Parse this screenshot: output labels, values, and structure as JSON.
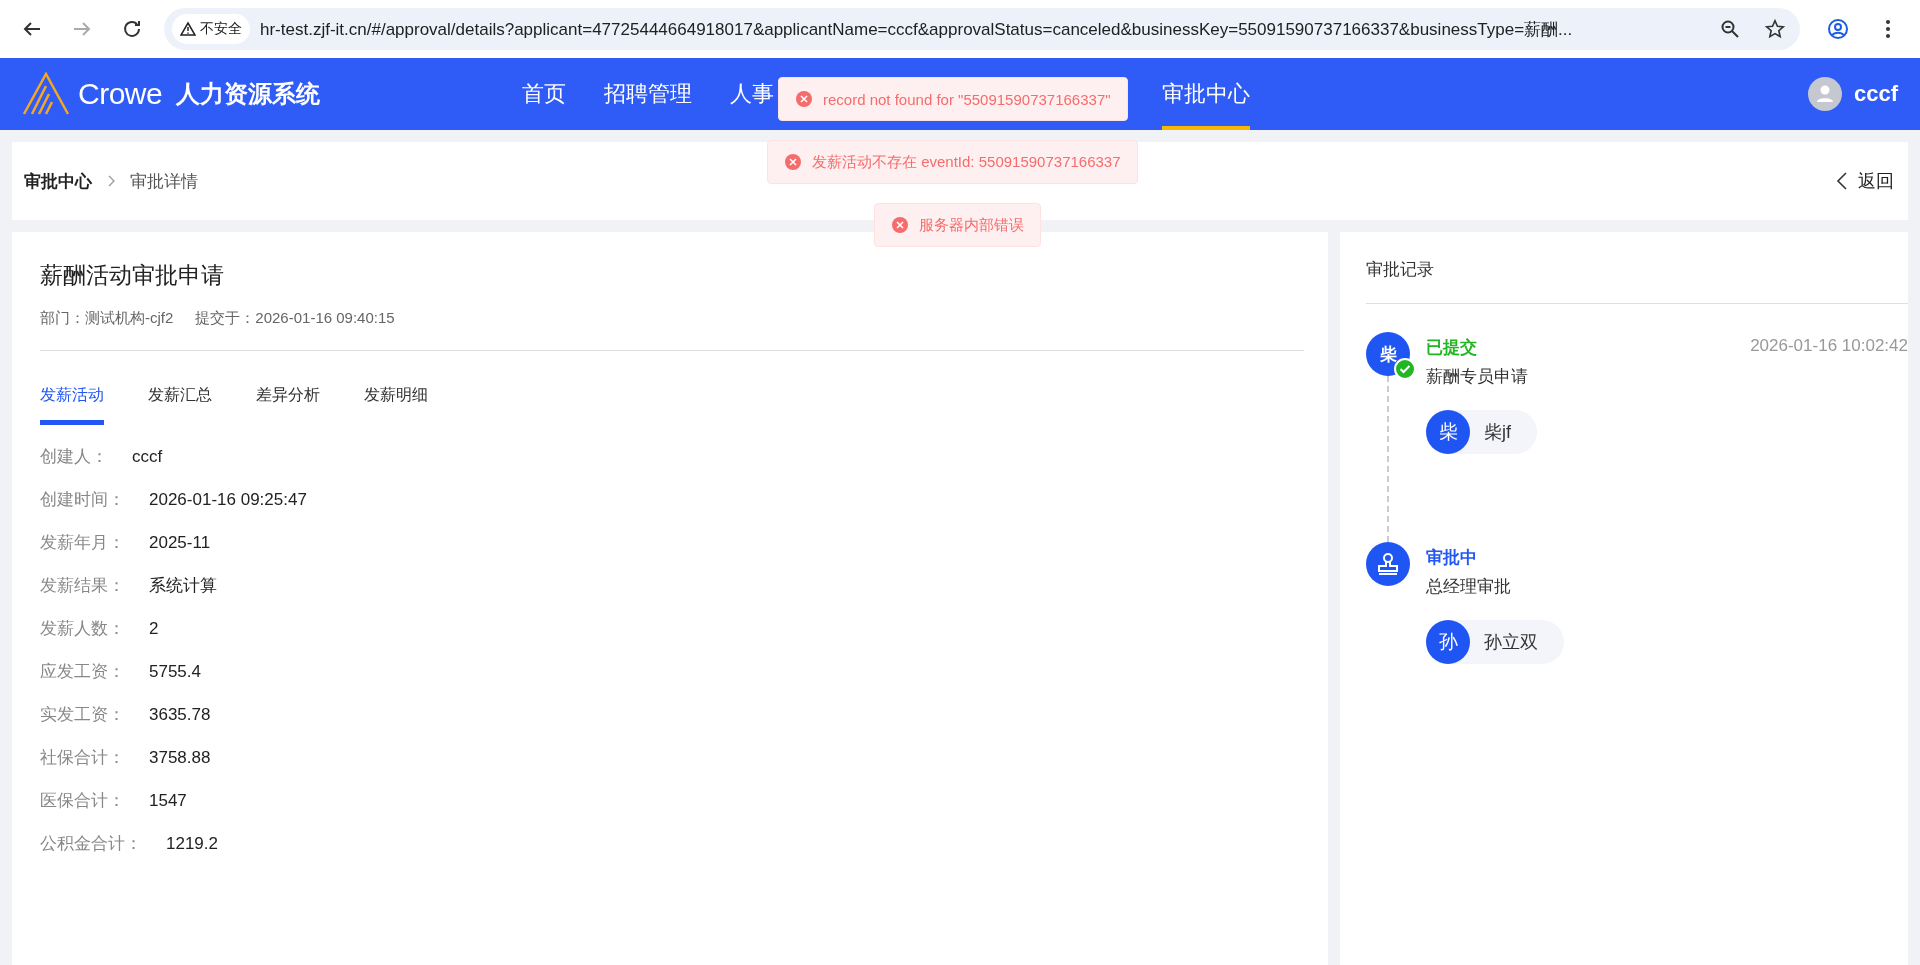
{
  "browser": {
    "security_label": "不安全",
    "url": "hr-test.zjf-it.cn/#/approval/details?applicant=47725444664918017&applicantName=cccf&approvalStatus=canceled&businessKey=55091590737166337&businessType=薪酬..."
  },
  "header": {
    "logo_text": "Crowe",
    "system_name": "人力资源系统",
    "nav": [
      {
        "label": "首页",
        "selected": false
      },
      {
        "label": "招聘管理",
        "selected": false
      },
      {
        "label": "人事",
        "selected": false
      },
      {
        "label": "审批中心",
        "selected": true
      }
    ],
    "user": "cccf"
  },
  "toasts": [
    {
      "message": "record not found for \"55091590737166337\""
    },
    {
      "message": "发薪活动不存在 eventId: 55091590737166337"
    },
    {
      "message": "服务器内部错误"
    }
  ],
  "breadcrumb": {
    "items": [
      "审批中心",
      "审批详情"
    ],
    "back": "返回"
  },
  "detail": {
    "title": "薪酬活动审批申请",
    "department": "部门：测试机构-cjf2",
    "submitted": "提交于：2026-01-16 09:40:15",
    "tabs": [
      {
        "label": "发薪活动",
        "selected": true
      },
      {
        "label": "发薪汇总",
        "selected": false
      },
      {
        "label": "差异分析",
        "selected": false
      },
      {
        "label": "发薪明细",
        "selected": false
      }
    ],
    "fields": [
      {
        "label": "创建人：",
        "value": "cccf"
      },
      {
        "label": "创建时间：",
        "value": "2026-01-16 09:25:47"
      },
      {
        "label": "发薪年月：",
        "value": "2025-11"
      },
      {
        "label": "发薪结果：",
        "value": "系统计算"
      },
      {
        "label": "发薪人数：",
        "value": "2"
      },
      {
        "label": "应发工资：",
        "value": "5755.4"
      },
      {
        "label": "实发工资：",
        "value": "3635.78"
      },
      {
        "label": "社保合计：",
        "value": "3758.88"
      },
      {
        "label": "医保合计：",
        "value": "1547"
      },
      {
        "label": "公积金合计：",
        "value": "1219.2"
      }
    ]
  },
  "approval_records": {
    "title": "审批记录",
    "steps": [
      {
        "kind": "submitted",
        "node_text": "柴",
        "status": "已提交",
        "time": "2026-01-16 10:02:42",
        "step": "薪酬专员申请",
        "approvers": [
          {
            "initial": "柴",
            "name": "柴jf"
          }
        ]
      },
      {
        "kind": "pending",
        "status": "审批中",
        "step": "总经理审批",
        "approvers": [
          {
            "initial": "孙",
            "name": "孙立双"
          }
        ]
      }
    ]
  }
}
